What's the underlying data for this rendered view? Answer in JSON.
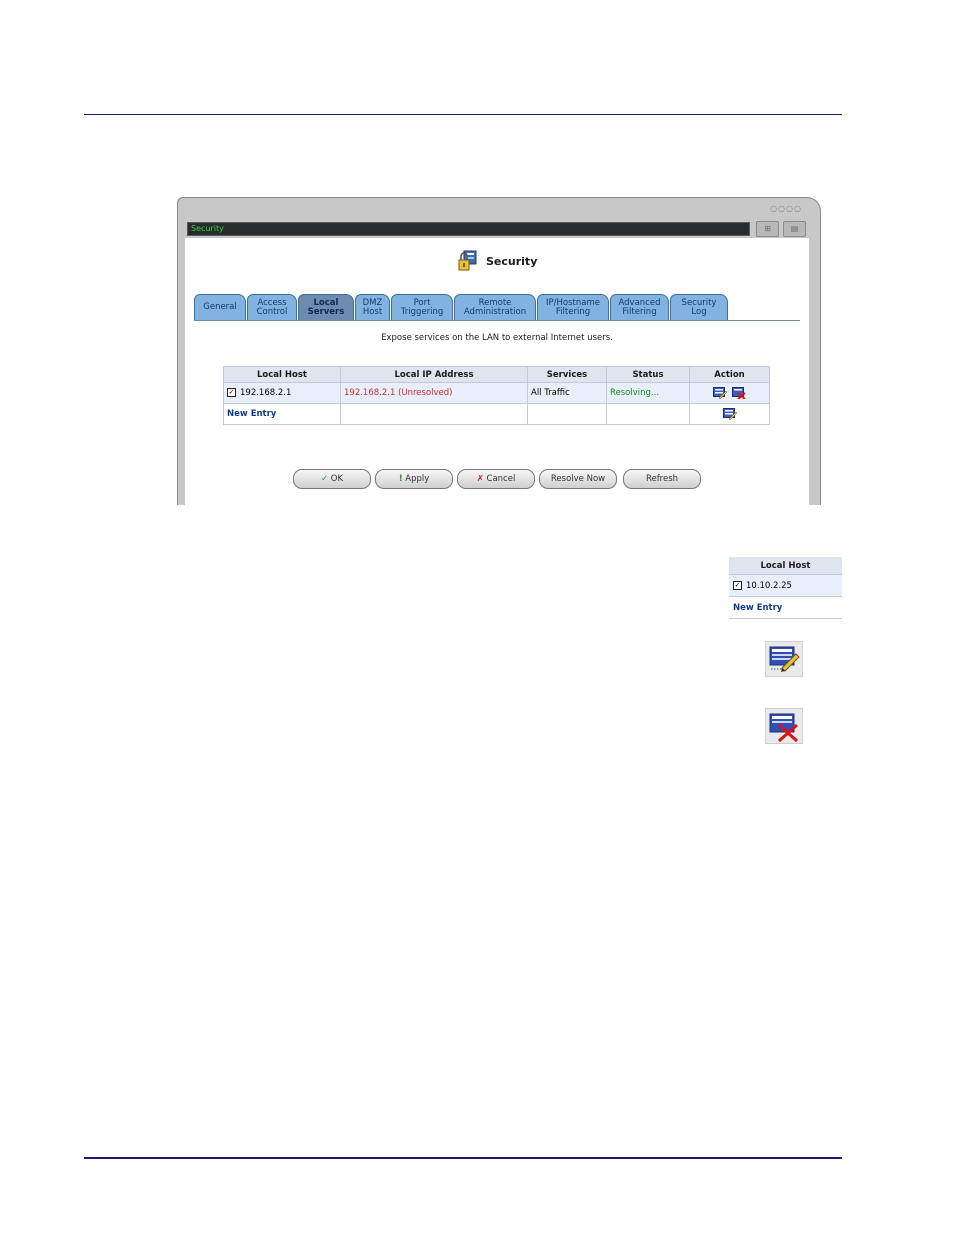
{
  "window": {
    "title": "Security",
    "header_title": "Security"
  },
  "tabs": [
    {
      "label": "General"
    },
    {
      "label": "Access\nControl"
    },
    {
      "label": "Local\nServers",
      "active": true
    },
    {
      "label": "DMZ\nHost"
    },
    {
      "label": "Port\nTriggering"
    },
    {
      "label": "Remote\nAdministration"
    },
    {
      "label": "IP/Hostname\nFiltering"
    },
    {
      "label": "Advanced\nFiltering"
    },
    {
      "label": "Security\nLog"
    }
  ],
  "description": "Expose services on the LAN to external Internet users.",
  "table": {
    "headers": [
      "Local Host",
      "Local IP Address",
      "Services",
      "Status",
      "Action"
    ],
    "rows": [
      {
        "checked": true,
        "local_host": "192.168.2.1",
        "local_ip": "192.168.2.1 (Unresolved)",
        "services": "All Traffic",
        "status": "Resolving..."
      }
    ],
    "new_entry": "New Entry"
  },
  "buttons": {
    "ok": "OK",
    "apply": "Apply",
    "cancel": "Cancel",
    "resolve_now": "Resolve Now",
    "refresh": "Refresh"
  },
  "mini_table": {
    "header": "Local Host",
    "row_host": "10.10.2.25",
    "row_checked": true,
    "new_entry": "New Entry"
  },
  "icons": {
    "edit": "edit-entry-icon",
    "delete": "delete-entry-icon",
    "security": "security-icon"
  },
  "colors": {
    "tab": "#82b3e0",
    "tab_active": "#6e8bb0",
    "unresolved": "#d12b2b",
    "resolving": "#199119",
    "title_text": "#3fd13f",
    "rule": "#1a1a6e"
  }
}
